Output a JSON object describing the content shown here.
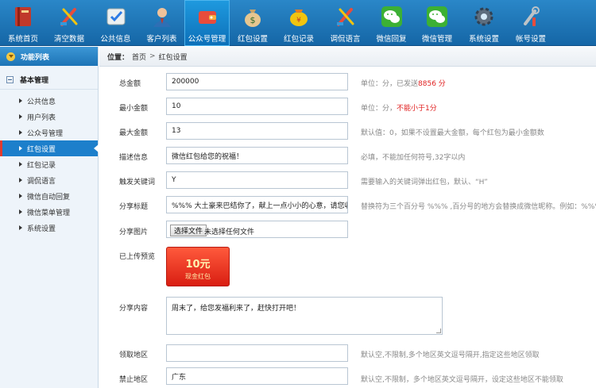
{
  "toolbar": {
    "items": [
      {
        "label": "系统首页",
        "icon": "book-icon"
      },
      {
        "label": "清空数据",
        "icon": "tools-icon"
      },
      {
        "label": "公共信息",
        "icon": "check-board-icon"
      },
      {
        "label": "客户列表",
        "icon": "user-icon"
      },
      {
        "label": "公众号管理",
        "icon": "wallet-icon"
      },
      {
        "label": "红包设置",
        "icon": "money-bag-icon"
      },
      {
        "label": "红包记录",
        "icon": "coin-bag-icon"
      },
      {
        "label": "调侃语言",
        "icon": "tools-icon"
      },
      {
        "label": "微信回复",
        "icon": "wechat-icon"
      },
      {
        "label": "微信管理",
        "icon": "wechat-icon"
      },
      {
        "label": "系统设置",
        "icon": "gear-icon"
      },
      {
        "label": "帐号设置",
        "icon": "wrench-icon"
      }
    ],
    "active_index": 4
  },
  "sidebar": {
    "title": "功能列表",
    "group": "基本管理",
    "items": [
      {
        "label": "公共信息"
      },
      {
        "label": "用户列表"
      },
      {
        "label": "公众号管理"
      },
      {
        "label": "红包设置"
      },
      {
        "label": "红包记录"
      },
      {
        "label": "调侃语言"
      },
      {
        "label": "微信自动回复"
      },
      {
        "label": "微信菜单管理"
      },
      {
        "label": "系统设置"
      }
    ],
    "active_index": 3
  },
  "breadcrumb": {
    "prefix": "位置：",
    "home": "首页",
    "sep": ">",
    "current": "红包设置"
  },
  "form": {
    "total": {
      "label": "总金额",
      "value": "200000",
      "hint_pre": "单位：分，已发送",
      "hint_red": "8856 分"
    },
    "min": {
      "label": "最小金额",
      "value": "10",
      "hint_pre": "单位：分，",
      "hint_red": "不能小于1分"
    },
    "max": {
      "label": "最大金额",
      "value": "13",
      "hint": "默认值：0，如果不设置最大金额，每个红包为最小金额数"
    },
    "desc": {
      "label": "描述信息",
      "value": "微信红包给您的祝福！",
      "hint": "必填，不能加任何符号,32字以内"
    },
    "keyword": {
      "label": "触发关键词",
      "value": "Y",
      "hint": "需要输入的关键词弹出红包，默认、“H”"
    },
    "share_title": {
      "label": "分享标题",
      "value": "%%% 大土豪来巴结你了，献上一点小小的心意，请您收下！",
      "hint": "替换符为三个百分号 %%% ,百分号的地方会替换成微信昵称。例如：%%%的红包"
    },
    "share_image": {
      "label": "分享图片",
      "button": "选择文件",
      "status": "未选择任何文件"
    },
    "preview": {
      "label": "已上传预览",
      "amount": "10元",
      "caption": "现金红包"
    },
    "share_content": {
      "label": "分享内容",
      "value": "周末了，给您发福利来了，赶快打开吧！"
    },
    "region": {
      "label": "领取地区",
      "value": "",
      "hint": "默认空,不限制,多个地区英文逗号隔开,指定这些地区领取"
    },
    "banned": {
      "label": "禁止地区",
      "value": "广东",
      "hint": "默认空,不限制，多个地区英文逗号隔开，设定这些地区不能领取"
    }
  },
  "colors": {
    "toolbar": "#1a6fb0",
    "accent": "#1d7fcb",
    "warning": "#e02020"
  }
}
